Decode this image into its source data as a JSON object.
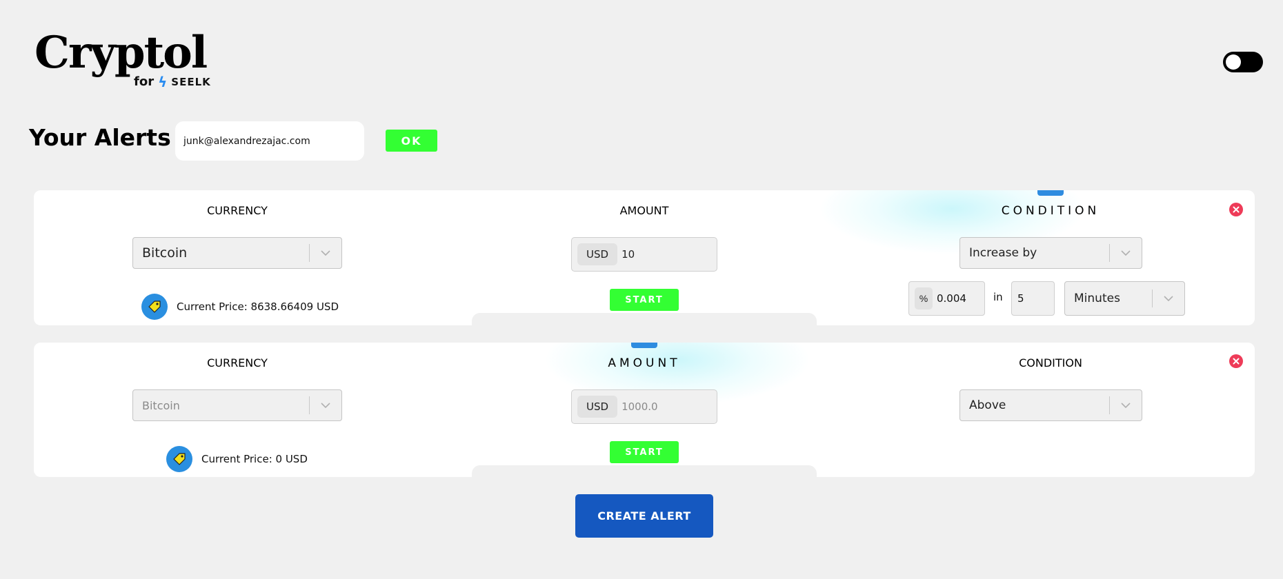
{
  "header": {
    "logo_text": "Cryptol",
    "logo_for": "for",
    "logo_brand": "SEELK"
  },
  "alerts_section": {
    "heading": "Your Alerts",
    "email_value": "junk@alexandrezajac.com",
    "ok_label": "OK"
  },
  "alerts": [
    {
      "currency_label": "CURRENCY",
      "amount_label": "AMOUNT",
      "condition_label": "CONDITION",
      "currency": "Bitcoin",
      "amount_unit": "USD",
      "amount": "10",
      "start_label": "START",
      "current_price": "Current Price: 8638.66409 USD",
      "condition": "Increase by",
      "percent_unit": "%",
      "percent_value": "0.004",
      "in_label": "in",
      "period_value": "5",
      "period_unit": "Minutes"
    },
    {
      "currency_label": "CURRENCY",
      "amount_label": "AMOUNT",
      "condition_label": "CONDITION",
      "currency": "Bitcoin",
      "amount_unit": "USD",
      "amount": "1000.0",
      "start_label": "START",
      "current_price": "Current Price: 0 USD",
      "condition": "Above"
    }
  ],
  "create_alert_label": "CREATE ALERT",
  "colors": {
    "accent_green": "#33ff33",
    "primary_blue": "#1558c0",
    "tag_blue": "#2a8fe0",
    "delete_red": "#ee3b58",
    "background": "#f0f0f0"
  },
  "icons": {
    "theme_toggle": "toggle-icon",
    "tag": "price-tag-icon",
    "delete": "close-icon",
    "dropdown": "chevron-down-icon"
  }
}
